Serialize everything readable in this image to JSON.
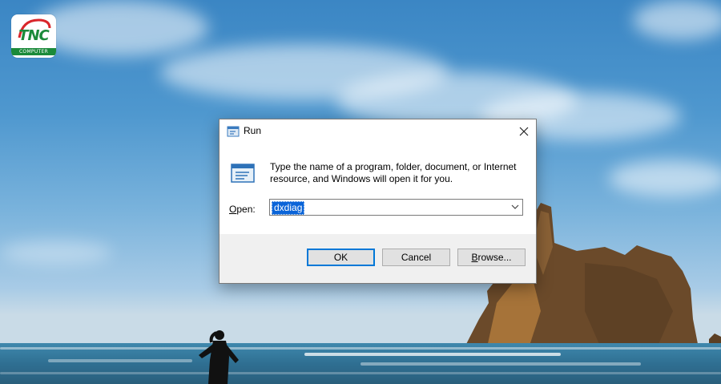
{
  "logo": {
    "text": "TNC",
    "sub": "COMPUTER"
  },
  "dialog": {
    "title": "Run",
    "description": "Type the name of a program, folder, document, or Internet resource, and Windows will open it for you.",
    "open_label_prefix": "",
    "open_label_accel": "O",
    "open_label_rest": "pen:",
    "input_value": "dxdiag",
    "buttons": {
      "ok": "OK",
      "cancel": "Cancel",
      "browse_accel": "B",
      "browse_rest": "rowse..."
    }
  },
  "colors": {
    "accent": "#0078d7",
    "selection": "#0a64d8",
    "logo_green": "#1b8a3a"
  },
  "icons": {
    "title": "run-icon",
    "big": "run-icon",
    "close": "close-icon",
    "dropdown": "chevron-down-icon"
  }
}
